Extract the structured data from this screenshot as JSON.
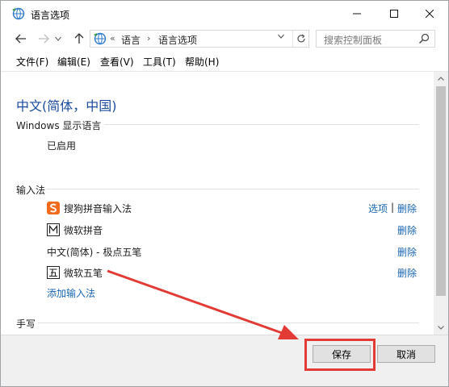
{
  "window": {
    "title": "语言选项",
    "controls": {
      "minimize": "—",
      "maximize": "☐",
      "close": "✕"
    }
  },
  "nav": {
    "back_icon": "arrow-left-icon",
    "forward_icon": "arrow-right-icon",
    "up_icon": "arrow-up-icon",
    "breadcrumb_overflow": "«",
    "breadcrumb": [
      "语言",
      "语言选项"
    ],
    "breadcrumb_sep": "›",
    "search_placeholder": "搜索控制面板"
  },
  "menu": [
    "文件(F)",
    "编辑(E)",
    "查看(V)",
    "工具(T)",
    "帮助(H)"
  ],
  "content": {
    "language_title": "中文(简体，中国)",
    "display_language": {
      "heading": "Windows 显示语言",
      "status": "已启用"
    },
    "input_method": {
      "heading": "输入法",
      "items": [
        {
          "name": "搜狗拼音输入法",
          "icon": "sogou-s-icon",
          "options_label": "选项",
          "separator": "|",
          "remove_label": "删除"
        },
        {
          "name": "微软拼音",
          "icon": "m-box-icon",
          "remove_label": "删除"
        },
        {
          "name": "中文(简体) - 极点五笔",
          "icon": "",
          "remove_label": "删除"
        },
        {
          "name": "微软五笔",
          "icon": "wu-box-icon",
          "remove_label": "删除"
        }
      ],
      "add_label": "添加输入法"
    },
    "handwriting": {
      "heading": "手写"
    }
  },
  "footer": {
    "save_label": "保存",
    "cancel_label": "取消"
  },
  "colors": {
    "accent": "#1a66b3",
    "title_blue": "#1a4b9c",
    "annotation_red": "#e23b36"
  }
}
